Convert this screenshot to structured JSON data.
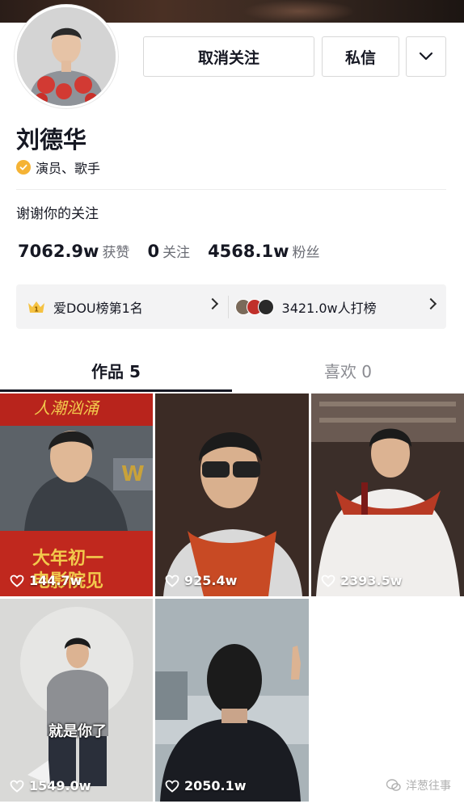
{
  "profile": {
    "name": "刘德华",
    "verify_text": "演员、歌手",
    "bio": "谢谢你的关注"
  },
  "actions": {
    "unfollow_label": "取消关注",
    "message_label": "私信"
  },
  "stats": [
    {
      "value": "7062.9w",
      "label": "获赞"
    },
    {
      "value": "0",
      "label": "关注"
    },
    {
      "value": "4568.1w",
      "label": "粉丝"
    }
  ],
  "rank": {
    "left_text": "爱DOU榜第1名",
    "right_text": "3421.0w人打榜"
  },
  "tabs": [
    {
      "label": "作品 5"
    },
    {
      "label": "喜欢 0"
    }
  ],
  "videos": [
    {
      "likes": "144.7w",
      "overlay_1": "大年初一",
      "overlay_2": "电影院见"
    },
    {
      "likes": "925.4w"
    },
    {
      "likes": "2393.5w"
    },
    {
      "likes": "1549.0w",
      "overlay_1": "就是你了"
    },
    {
      "likes": "2050.1w"
    }
  ],
  "watermark": "洋葱往事",
  "colors": {
    "verify_badge": "#f5b335",
    "text_primary": "#161823",
    "text_secondary": "#6b6d75"
  }
}
